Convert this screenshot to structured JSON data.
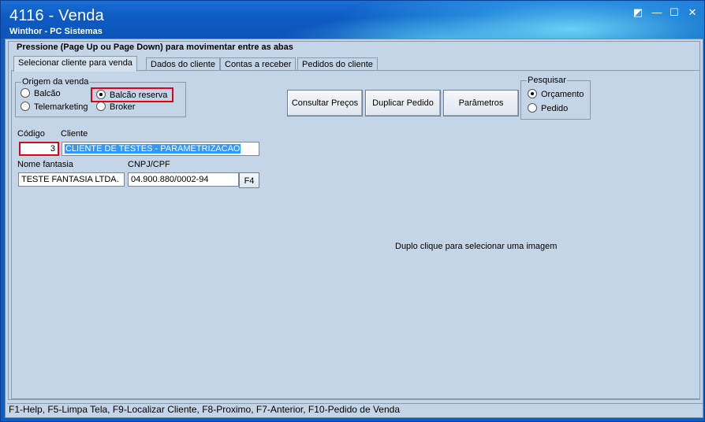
{
  "window": {
    "title": "4116 - Venda",
    "subtitle": "Winthor - PC Sistemas",
    "controls": {
      "restore": "◩",
      "minimize": "—",
      "maximize": "☐",
      "close": "✕"
    }
  },
  "main_group": {
    "title": "Pressione (Page Up ou Page Down) para movimentar entre as abas"
  },
  "tabs": [
    {
      "label": "Selecionar cliente para venda",
      "active": true
    },
    {
      "label": "Dados do cliente"
    },
    {
      "label": "Contas a receber"
    },
    {
      "label": "Pedidos do cliente"
    }
  ],
  "origem": {
    "title": "Origem da venda",
    "options": [
      "Balcão",
      "Balcão reserva",
      "Telemarketing",
      "Broker"
    ],
    "selected": "Balcão reserva"
  },
  "buttons": {
    "consultar_precos": "Consultar Preços",
    "duplicar_pedido": "Duplicar Pedido",
    "parametros": "Parâmetros",
    "f4": "F4"
  },
  "pesquisar": {
    "title": "Pesquisar",
    "options": [
      "Orçamento",
      "Pedido"
    ],
    "selected": "Orçamento"
  },
  "form": {
    "codigo_label": "Código",
    "codigo_value": "3",
    "cliente_label": "Cliente",
    "cliente_value": "CLIENTE DE TESTES - PARAMETRIZACAO",
    "fantasia_label": "Nome fantasia",
    "fantasia_value": "TESTE FANTASIA LTDA.",
    "cnpj_label": "CNPJ/CPF",
    "cnpj_value": "04.900.880/0002-94"
  },
  "image_hint": "Duplo clique para selecionar uma imagem",
  "status_bar": "F1-Help, F5-Limpa Tela, F9-Localizar Cliente, F8-Proximo, F7-Anterior, F10-Pedido de Venda",
  "colors": {
    "highlight_red": "#e0001a",
    "panel_bg": "#c4d5e8",
    "title_blue": "#0d5cc4",
    "selection": "#3399ff"
  }
}
